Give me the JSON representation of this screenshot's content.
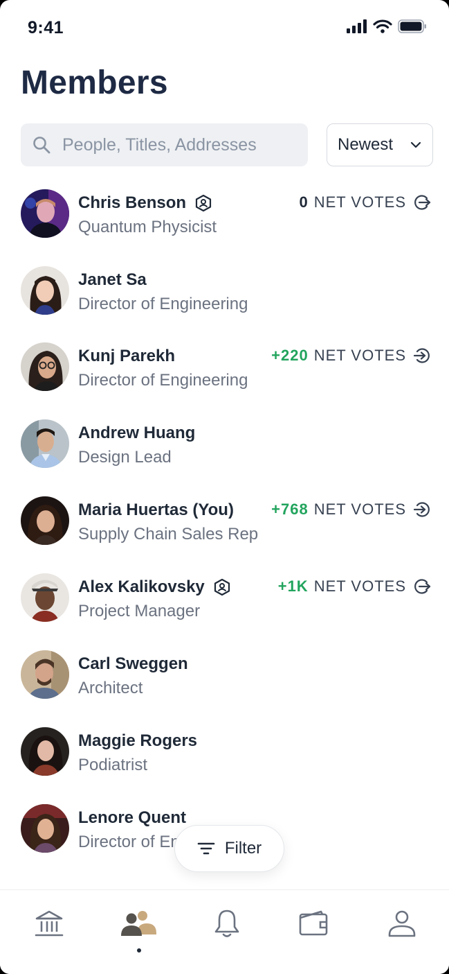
{
  "status_bar": {
    "time": "9:41"
  },
  "page": {
    "title": "Members"
  },
  "search": {
    "placeholder": "People, Titles, Addresses",
    "value": ""
  },
  "sort": {
    "selected": "Newest"
  },
  "members": [
    {
      "name": "Chris Benson",
      "title": "Quantum Physicist",
      "badge": true,
      "votes": "0",
      "votes_label": "NET VOTES",
      "vote_icon": "arrow-right-circle-icon"
    },
    {
      "name": "Janet Sa",
      "title": "Director of Engineering",
      "badge": false,
      "votes": null
    },
    {
      "name": "Kunj Parekh",
      "title": "Director of Engineering",
      "badge": false,
      "votes": "+220",
      "votes_label": "NET VOTES",
      "vote_icon": "arrow-in-circle-icon"
    },
    {
      "name": "Andrew Huang",
      "title": "Design Lead",
      "badge": false,
      "votes": null
    },
    {
      "name": "Maria Huertas (You)",
      "title": "Supply Chain Sales Rep",
      "badge": false,
      "votes": "+768",
      "votes_label": "NET VOTES",
      "vote_icon": "arrow-in-circle-icon"
    },
    {
      "name": "Alex Kalikovsky",
      "title": "Project Manager",
      "badge": true,
      "votes": "+1K",
      "votes_label": "NET VOTES",
      "vote_icon": "arrow-right-circle-icon"
    },
    {
      "name": "Carl Sweggen",
      "title": "Architect",
      "badge": false,
      "votes": null
    },
    {
      "name": "Maggie Rogers",
      "title": "Podiatrist",
      "badge": false,
      "votes": null
    },
    {
      "name": "Lenore Quent",
      "title": "Director of Engineering",
      "badge": false,
      "votes": null
    }
  ],
  "filter_button": {
    "label": "Filter"
  },
  "tabbar": {
    "items": [
      {
        "icon": "bank-icon",
        "active": false
      },
      {
        "icon": "members-icon",
        "active": true
      },
      {
        "icon": "bell-icon",
        "active": false
      },
      {
        "icon": "wallet-icon",
        "active": false
      },
      {
        "icon": "profile-icon",
        "active": false
      }
    ]
  },
  "colors": {
    "positive": "#22a45d",
    "title": "#1e2a44",
    "accent_tan": "#c8a97e"
  }
}
